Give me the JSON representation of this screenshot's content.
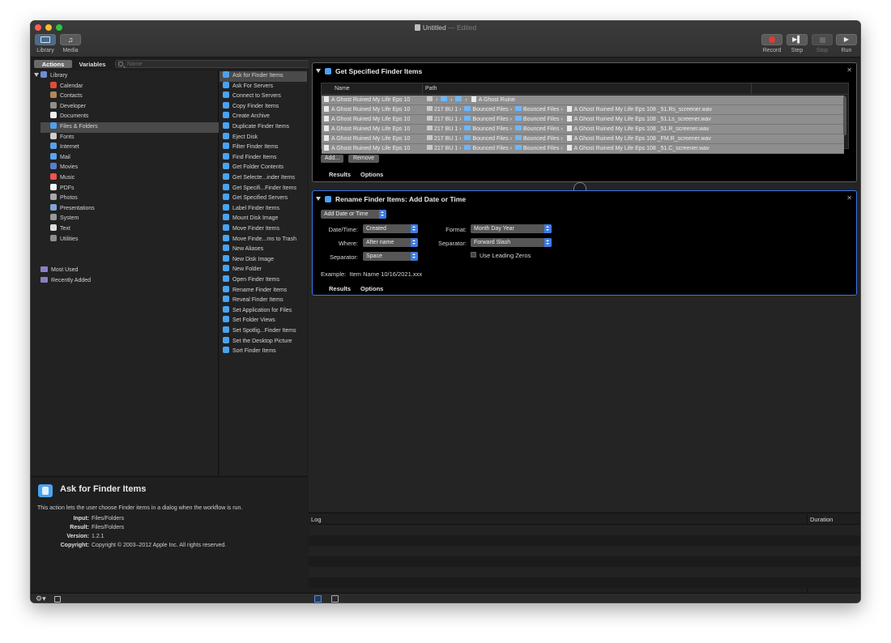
{
  "window": {
    "title": "Untitled",
    "title_suffix": "— Edited"
  },
  "toolbar": {
    "left": [
      {
        "label": "Library",
        "icon": "library-icon"
      },
      {
        "label": "Media",
        "icon": "media-icon"
      }
    ],
    "right": [
      {
        "label": "Record",
        "icon": "record-icon",
        "enabled": true
      },
      {
        "label": "Step",
        "icon": "step-icon",
        "enabled": true
      },
      {
        "label": "Stop",
        "icon": "stop-icon",
        "enabled": false
      },
      {
        "label": "Run",
        "icon": "run-icon",
        "enabled": true
      }
    ]
  },
  "tabs": {
    "actions": "Actions",
    "variables": "Variables",
    "search_placeholder": "Name"
  },
  "library": {
    "root": "Library",
    "items": [
      {
        "label": "Calendar",
        "color": "#e14b3b"
      },
      {
        "label": "Contacts",
        "color": "#b0895a"
      },
      {
        "label": "Developer",
        "color": "#8f8f8f"
      },
      {
        "label": "Documents",
        "color": "#f2f2f2"
      },
      {
        "label": "Files & Folders",
        "color": "#4aa3f0",
        "selected": true
      },
      {
        "label": "Fonts",
        "color": "#cfcfcf"
      },
      {
        "label": "Internet",
        "color": "#5a9ee6"
      },
      {
        "label": "Mail",
        "color": "#5aa5f0"
      },
      {
        "label": "Movies",
        "color": "#5b7ec8"
      },
      {
        "label": "Music",
        "color": "#f05252"
      },
      {
        "label": "PDFs",
        "color": "#f2f2f2"
      },
      {
        "label": "Photos",
        "color": "#a7a7a7"
      },
      {
        "label": "Presentations",
        "color": "#7fa6d6"
      },
      {
        "label": "System",
        "color": "#9a9a9a"
      },
      {
        "label": "Text",
        "color": "#e0e0e0"
      },
      {
        "label": "Utilities",
        "color": "#8f8f8f"
      }
    ],
    "groups": [
      "Most Used",
      "Recently Added"
    ]
  },
  "actions": [
    {
      "label": "Ask for Finder Items",
      "selected": true
    },
    {
      "label": "Ask For Servers"
    },
    {
      "label": "Connect to Servers"
    },
    {
      "label": "Copy Finder Items"
    },
    {
      "label": "Create Archive"
    },
    {
      "label": "Duplicate Finder Items"
    },
    {
      "label": "Eject Disk"
    },
    {
      "label": "Filter Finder Items"
    },
    {
      "label": "Find Finder Items"
    },
    {
      "label": "Get Folder Contents"
    },
    {
      "label": "Get Selecte...inder Items"
    },
    {
      "label": "Get Specifi...Finder Items"
    },
    {
      "label": "Get Specified Servers"
    },
    {
      "label": "Label Finder Items"
    },
    {
      "label": "Mount Disk Image"
    },
    {
      "label": "Move Finder Items"
    },
    {
      "label": "Move Finde...ms to Trash"
    },
    {
      "label": "New Aliases"
    },
    {
      "label": "New Disk Image"
    },
    {
      "label": "New Folder"
    },
    {
      "label": "Open Finder Items"
    },
    {
      "label": "Rename Finder Items"
    },
    {
      "label": "Reveal Finder Items"
    },
    {
      "label": "Set Application for Files"
    },
    {
      "label": "Set Folder Views"
    },
    {
      "label": "Set Spotlig...Finder Items"
    },
    {
      "label": "Set the Desktop Picture"
    },
    {
      "label": "Sort Finder Items"
    }
  ],
  "description": {
    "title": "Ask for Finder Items",
    "text": "This action lets the user choose Finder items in a dialog when the workflow is run.",
    "fields": [
      {
        "key": "Input:",
        "value": "Files/Folders"
      },
      {
        "key": "Result:",
        "value": "Files/Folders"
      },
      {
        "key": "Version:",
        "value": "1.2.1"
      },
      {
        "key": "Copyright:",
        "value": "Copyright © 2003–2012 Apple Inc.  All rights reserved."
      }
    ]
  },
  "card1": {
    "title": "Get Specified Finder Items",
    "columns": {
      "name": "Name",
      "path": "Path"
    },
    "rows": [
      {
        "name": "A Ghost Ruined My Life Eps 10",
        "path": [
          "",
          "",
          "",
          "A Ghost Ruine"
        ],
        "kinds": [
          "disk",
          "blue",
          "blue",
          "file"
        ]
      },
      {
        "name": "A Ghost Ruined My Life Eps 10",
        "path": [
          "217 BU 1",
          "Bounced Files",
          "Bounced Files",
          "A Ghost Ruined My Life Eps 108 _51.Rs_screener.wav"
        ],
        "kinds": [
          "disk",
          "blue",
          "blue",
          "file"
        ]
      },
      {
        "name": "A Ghost Ruined My Life Eps 10",
        "path": [
          "217 BU 1",
          "Bounced Files",
          "Bounced Files",
          "A Ghost Ruined My Life Eps 108 _51.Ls_screener.wav"
        ],
        "kinds": [
          "disk",
          "blue",
          "blue",
          "file"
        ]
      },
      {
        "name": "A Ghost Ruined My Life Eps 10",
        "path": [
          "217 BU 1",
          "Bounced Files",
          "Bounced Files",
          "A Ghost Ruined My Life Eps 108 _51.R_screener.wav"
        ],
        "kinds": [
          "disk",
          "blue",
          "blue",
          "file"
        ]
      },
      {
        "name": "A Ghost Ruined My Life Eps 10",
        "path": [
          "217 BU 1",
          "Bounced Files",
          "Bounced Files",
          "A Ghost Ruined My Life Eps 108 _FM.R_screener.wav"
        ],
        "kinds": [
          "disk",
          "blue",
          "blue",
          "file"
        ]
      },
      {
        "name": "A Ghost Ruined My Life Eps 10",
        "path": [
          "217 BU 1",
          "Bounced Files",
          "Bounced Files",
          "A Ghost Ruined My Life Eps 108 _51.C_screener.wav"
        ],
        "kinds": [
          "disk",
          "blue",
          "blue",
          "file"
        ]
      }
    ],
    "add": "Add...",
    "remove": "Remove",
    "results": "Results",
    "options": "Options"
  },
  "card2": {
    "title": "Rename Finder Items: Add Date or Time",
    "mode": "Add Date or Time",
    "datetime_label": "Date/Time:",
    "datetime_value": "Created",
    "where_label": "Where:",
    "where_value": "After name",
    "sep1_label": "Separator:",
    "sep1_value": "Space",
    "format_label": "Format:",
    "format_value": "Month Day Year",
    "sep2_label": "Separator:",
    "sep2_value": "Forward Slash",
    "leading_zeros": "Use Leading Zeros",
    "example_label": "Example:",
    "example_value": "Item Name 10/16/2021.xxx",
    "results": "Results",
    "options": "Options"
  },
  "log": {
    "log": "Log",
    "duration": "Duration"
  }
}
